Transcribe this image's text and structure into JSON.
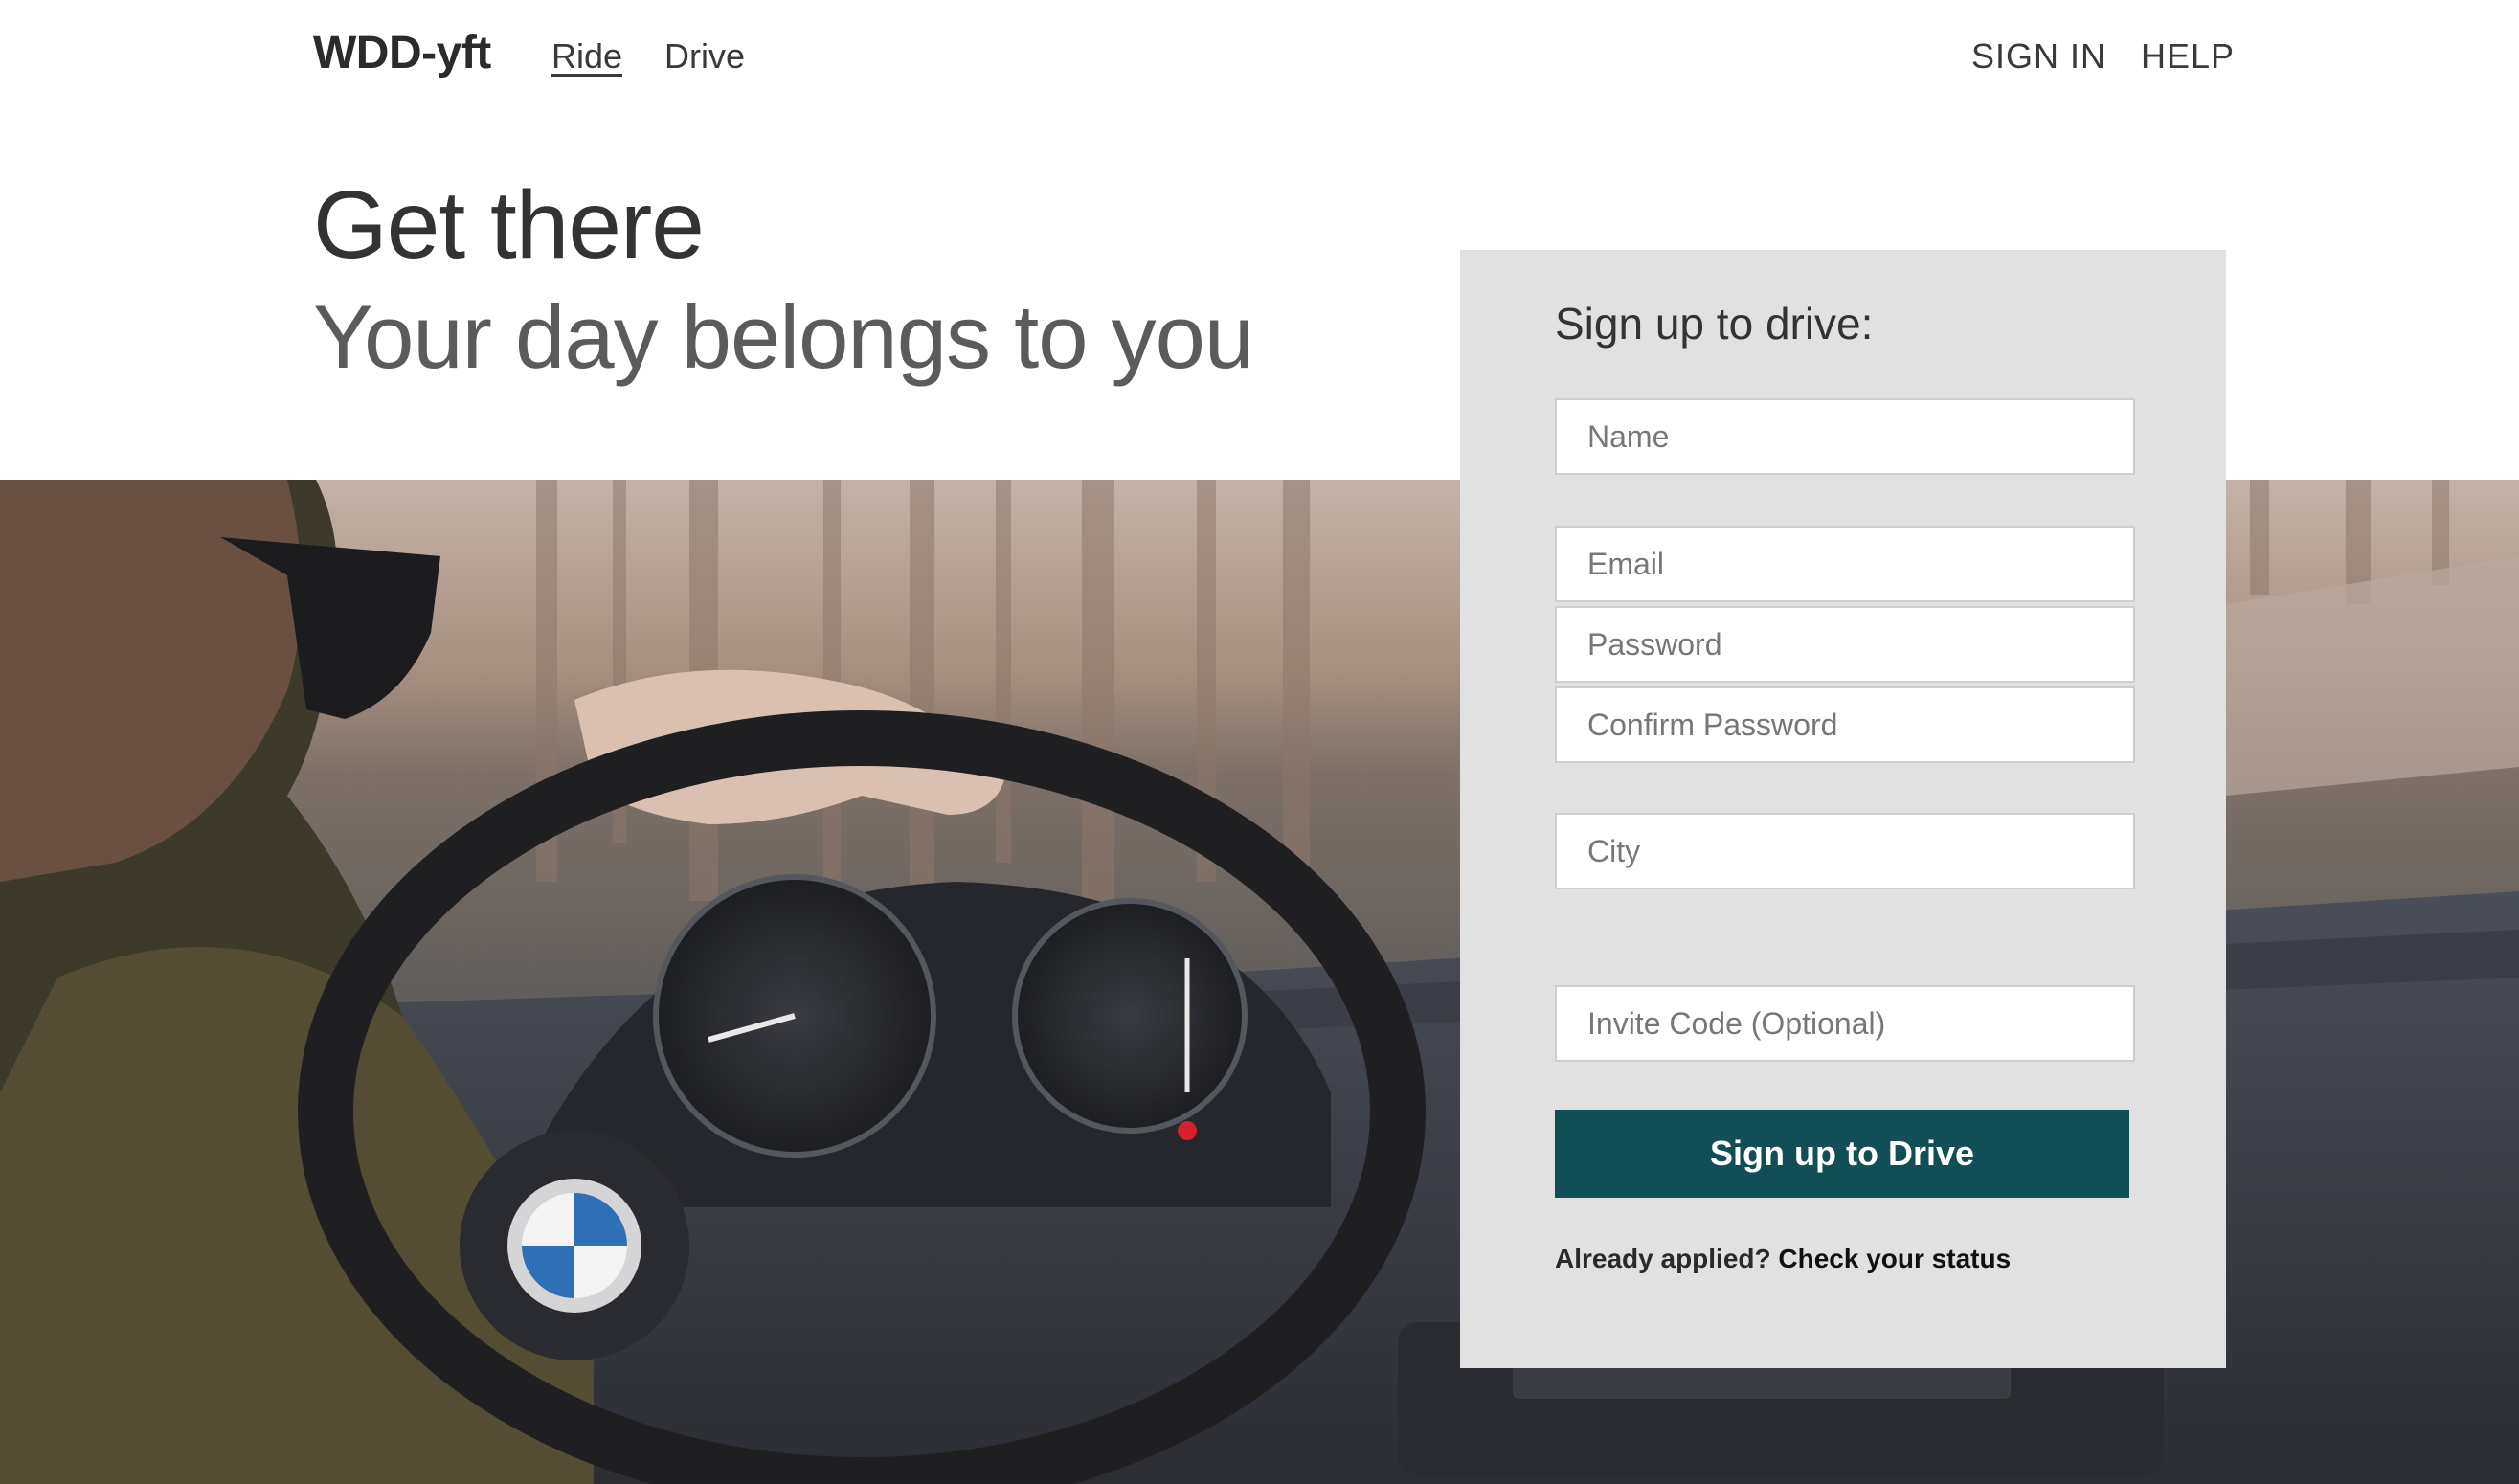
{
  "header": {
    "logo": "WDD-yft",
    "nav_left": [
      "Ride",
      "Drive"
    ],
    "nav_right": [
      "SIGN IN",
      "HELP"
    ]
  },
  "hero": {
    "title": "Get there",
    "subtitle": "Your day belongs to you"
  },
  "signup": {
    "heading": "Sign up to drive:",
    "fields": {
      "name": {
        "placeholder": "Name",
        "value": ""
      },
      "email": {
        "placeholder": "Email",
        "value": ""
      },
      "password": {
        "placeholder": "Password",
        "value": ""
      },
      "confirm_password": {
        "placeholder": "Confirm Password",
        "value": ""
      },
      "city": {
        "placeholder": "City",
        "value": ""
      },
      "invite_code": {
        "placeholder": "Invite Code (Optional)",
        "value": ""
      }
    },
    "button_label": "Sign up to Drive",
    "status_prompt": "Already applied?",
    "status_link": "Check your status"
  },
  "colors": {
    "button_bg": "#124e55",
    "panel_bg": "#e1e1e1"
  }
}
